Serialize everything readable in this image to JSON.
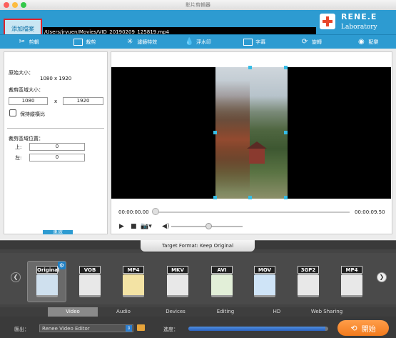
{
  "window": {
    "title": "影片剪輯器"
  },
  "header": {
    "add_file_label": "添加檔案",
    "file_path": "/Users/jryuen/Movies/VID_20190209_125819.mp4",
    "logo_line1": "RENE.E",
    "logo_line2": "Laboratory"
  },
  "toolbar": {
    "items": [
      {
        "label": "剪輯",
        "icon": "scissors-icon"
      },
      {
        "label": "裁剪",
        "icon": "crop-icon"
      },
      {
        "label": "濾鏡特效",
        "icon": "effects-icon"
      },
      {
        "label": "浮水印",
        "icon": "watermark-icon"
      },
      {
        "label": "字幕",
        "icon": "subtitle-icon"
      },
      {
        "label": "旋轉",
        "icon": "rotate-icon"
      },
      {
        "label": "配樂",
        "icon": "music-icon"
      }
    ]
  },
  "crop_panel": {
    "original_size_label": "原始大小：",
    "original_size_value": "1080 x 1920",
    "crop_size_label": "裁剪區域大小：",
    "crop_width": "1080",
    "crop_x_sep": "x",
    "crop_height": "1920",
    "keep_ratio_label": "保持縱橫比",
    "keep_ratio_checked": false,
    "crop_position_label": "裁剪區域位置：",
    "top_label": "上:",
    "top_value": "0",
    "left_label": "左:",
    "left_value": "0",
    "reset_label": "重設"
  },
  "player": {
    "current_time": "00:00:00.00",
    "total_time": "00:00:09.50",
    "play_icon": "play-icon",
    "stop_icon": "stop-icon",
    "camera_icon": "camera-icon",
    "volume_icon": "volume-icon"
  },
  "format_panel": {
    "target_format_label": "Target Format: Keep Original",
    "formats": [
      "Original",
      "VOB",
      "MP4",
      "MKV",
      "AVI",
      "MOV",
      "3GP2",
      "MP4"
    ],
    "categories": [
      "Video",
      "Audio",
      "Devices",
      "Editing",
      "HD",
      "Web Sharing"
    ],
    "active_category": "Video"
  },
  "footer": {
    "output_label": "匯出：",
    "output_value": "Renee Video Editor",
    "progress_label": "進度：",
    "progress_fraction": 0.98,
    "start_label": "開始"
  }
}
